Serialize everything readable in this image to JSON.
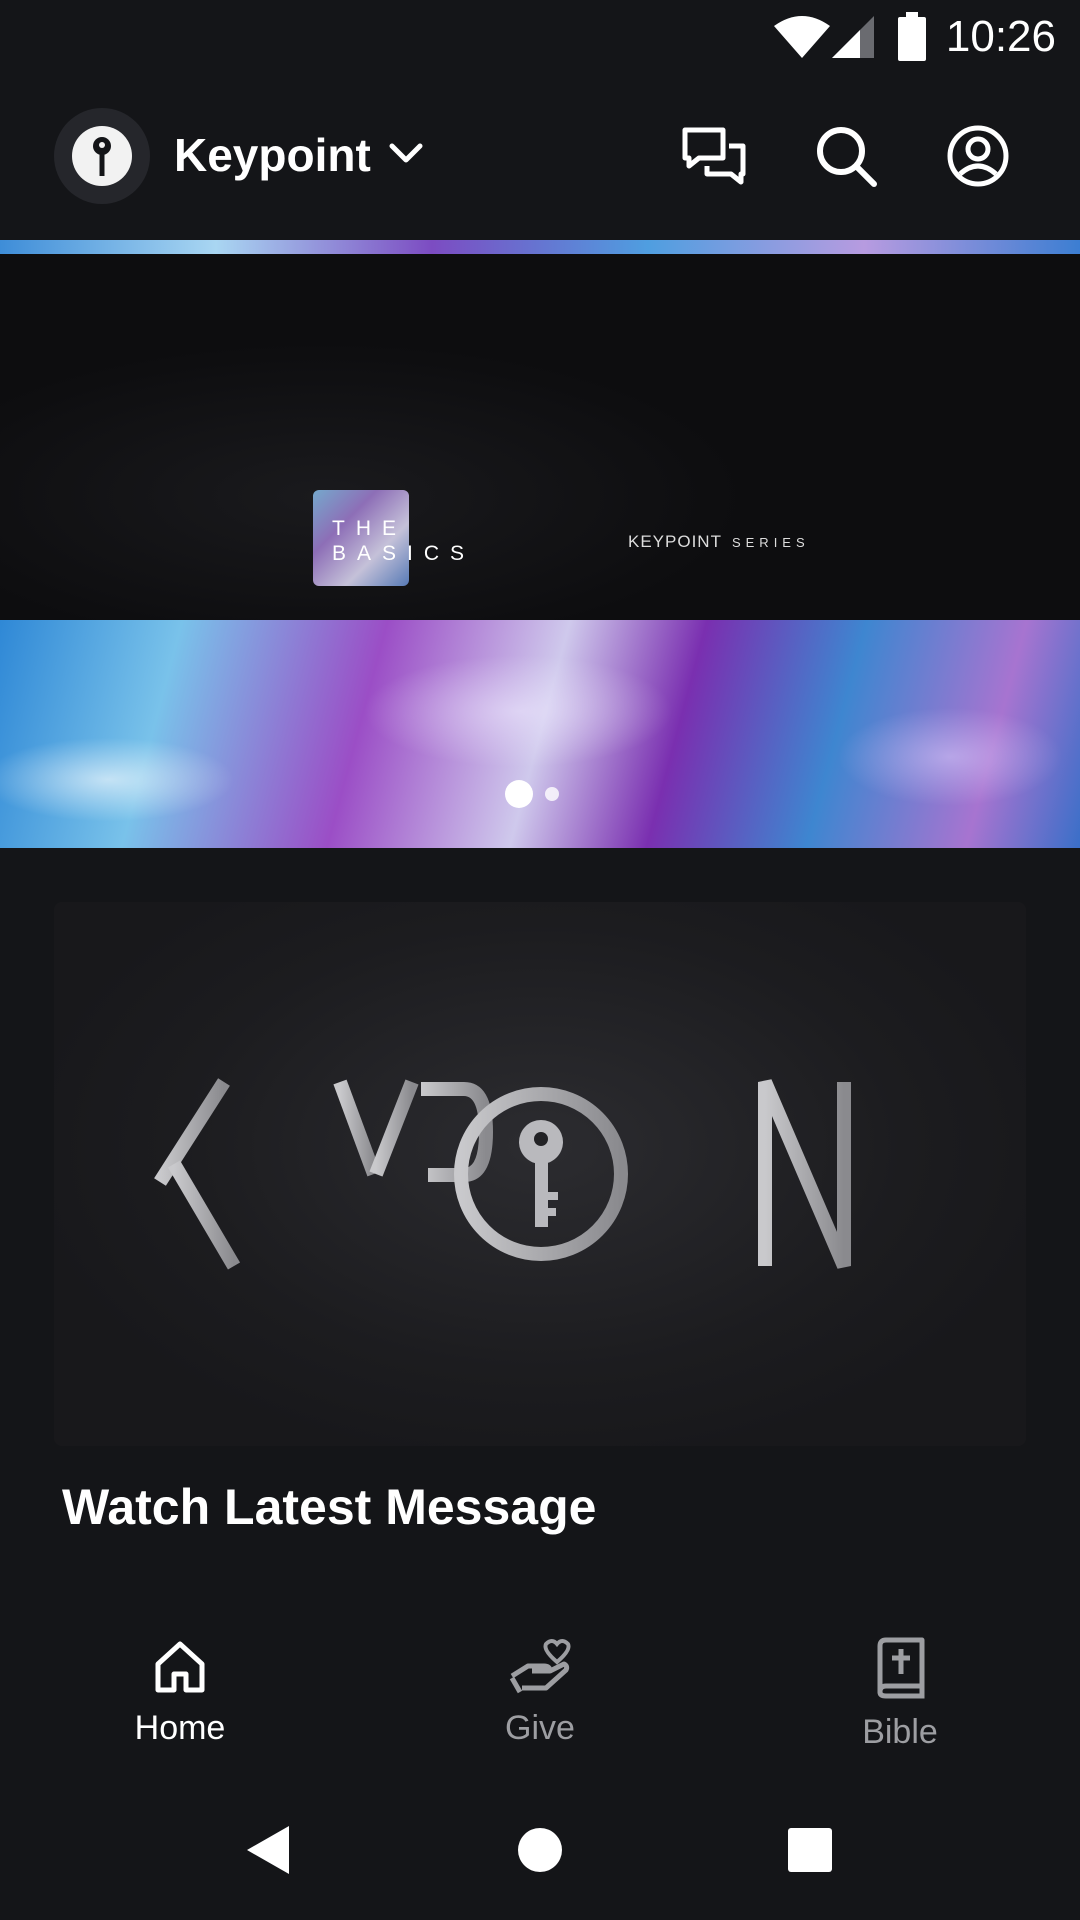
{
  "status_bar": {
    "time": "10:26",
    "icons": [
      "wifi-icon",
      "cell-signal-icon",
      "battery-icon"
    ]
  },
  "app_bar": {
    "org_name": "Keypoint",
    "actions": [
      "chat-icon",
      "search-icon",
      "account-icon"
    ]
  },
  "hero_carousel": {
    "slide_text_left": "THE BASICS",
    "slide_text_right_brand": "KEYPOINT",
    "slide_text_right_suffix": "SERIES",
    "page_count": 2,
    "active_page": 1
  },
  "latest_message": {
    "thumbnail_wordmark": "KEYPOINT",
    "title": "Watch Latest Message"
  },
  "bottom_nav": {
    "items": [
      {
        "label": "Home",
        "icon": "home-icon",
        "active": true
      },
      {
        "label": "Give",
        "icon": "give-icon",
        "active": false
      },
      {
        "label": "Bible",
        "icon": "bible-icon",
        "active": false
      }
    ]
  },
  "colors": {
    "background": "#141518",
    "active": "#ffffff",
    "inactive": "#9d9ea2"
  }
}
